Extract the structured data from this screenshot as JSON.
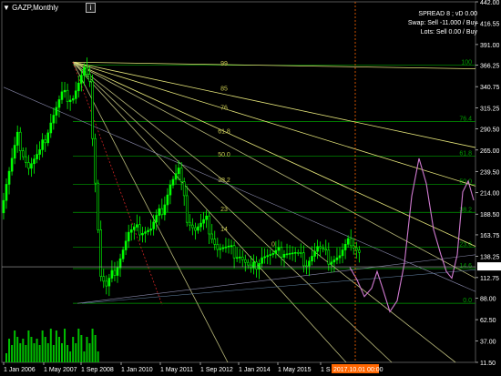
{
  "header": {
    "symbol_title": "GAZP,Monthly",
    "dropdown_glyph": "▼",
    "timeframe_button": "i"
  },
  "info_panel": {
    "spread": "SPREAD 8 ; vD 0.00",
    "swap": "Swap: Sell  -11.000 / Buy",
    "lots": "Lots:    Sell   0.00  /  Buy"
  },
  "colors": {
    "background": "#000000",
    "bull_candle": "#00ff00",
    "bear_candle": "#000000",
    "fan_lines": "#e6e67a",
    "fan_lines_soft": "#b8b87a",
    "fib_levels": "#00a000",
    "fib_labels": "#c8c850",
    "forecast": "#d07ad0",
    "volume": "#00c000",
    "price_line": "#aaaaaa",
    "current_time_marker": "#ff6600",
    "current_time_label_bg": "#ff6600",
    "price_label_bg": "#ffffff"
  },
  "chart_data": {
    "type": "candlestick",
    "symbol": "GAZP",
    "timeframe": "Monthly",
    "y_axis_ticks": [
      "442.00",
      "416.55",
      "391.00",
      "366.25",
      "340.75",
      "315.25",
      "290.50",
      "265.00",
      "239.50",
      "214.00",
      "188.50",
      "163.75",
      "138.25",
      "112.75",
      "88.00",
      "62.50",
      "37.00",
      "11.50"
    ],
    "ylim": [
      11.5,
      442.0
    ],
    "current_price": "125.55",
    "x_axis_ticks": [
      "1 Jan 2006",
      "1 May 2007",
      "1 Sep 2008",
      "1 Jan 2010",
      "1 May 2011",
      "1 Sep 2012",
      "1 Jan 2014",
      "1 May 2015",
      "1 S"
    ],
    "current_time_label": "2017.10.01 00:00",
    "fibonacci_fan_levels": [
      "99",
      "85",
      "76",
      "61.8",
      "50.0",
      "38.2",
      "23",
      "14",
      "0"
    ],
    "fibonacci_retracement_levels": [
      "100",
      "76.4",
      "61.8",
      "50.0",
      "38.2",
      "23.6",
      "14.6",
      "0.0"
    ],
    "series_close_approx": [
      {
        "x": "2005-01",
        "close": 70
      },
      {
        "x": "2005-06",
        "close": 90
      },
      {
        "x": "2005-11",
        "close": 190
      },
      {
        "x": "2006-01",
        "close": 225
      },
      {
        "x": "2006-05",
        "close": 280
      },
      {
        "x": "2006-09",
        "close": 245
      },
      {
        "x": "2007-01",
        "close": 260
      },
      {
        "x": "2007-05",
        "close": 300
      },
      {
        "x": "2007-09",
        "close": 330
      },
      {
        "x": "2008-01",
        "close": 330
      },
      {
        "x": "2008-05",
        "close": 360
      },
      {
        "x": "2008-07",
        "close": 340
      },
      {
        "x": "2008-09",
        "close": 230
      },
      {
        "x": "2008-11",
        "close": 115
      },
      {
        "x": "2009-01",
        "close": 100
      },
      {
        "x": "2009-05",
        "close": 130
      },
      {
        "x": "2009-09",
        "close": 165
      },
      {
        "x": "2010-01",
        "close": 170
      },
      {
        "x": "2010-05",
        "close": 170
      },
      {
        "x": "2010-09",
        "close": 195
      },
      {
        "x": "2010-12",
        "close": 225
      },
      {
        "x": "2011-03",
        "close": 240
      },
      {
        "x": "2011-06",
        "close": 185
      },
      {
        "x": "2011-09",
        "close": 170
      },
      {
        "x": "2012-01",
        "close": 180
      },
      {
        "x": "2012-05",
        "close": 148
      },
      {
        "x": "2012-09",
        "close": 145
      },
      {
        "x": "2013-01",
        "close": 140
      },
      {
        "x": "2013-05",
        "close": 120
      },
      {
        "x": "2013-09",
        "close": 140
      },
      {
        "x": "2014-01",
        "close": 138
      },
      {
        "x": "2014-05",
        "close": 145
      },
      {
        "x": "2014-09",
        "close": 140
      },
      {
        "x": "2015-01",
        "close": 132
      },
      {
        "x": "2015-05",
        "close": 148
      },
      {
        "x": "2015-09",
        "close": 135
      },
      {
        "x": "2016-01",
        "close": 138
      },
      {
        "x": "2016-05",
        "close": 158
      },
      {
        "x": "2016-09",
        "close": 140
      },
      {
        "x": "2017-01",
        "close": 165
      },
      {
        "x": "2017-05",
        "close": 128
      },
      {
        "x": "2017-09",
        "close": 125.55
      }
    ]
  }
}
